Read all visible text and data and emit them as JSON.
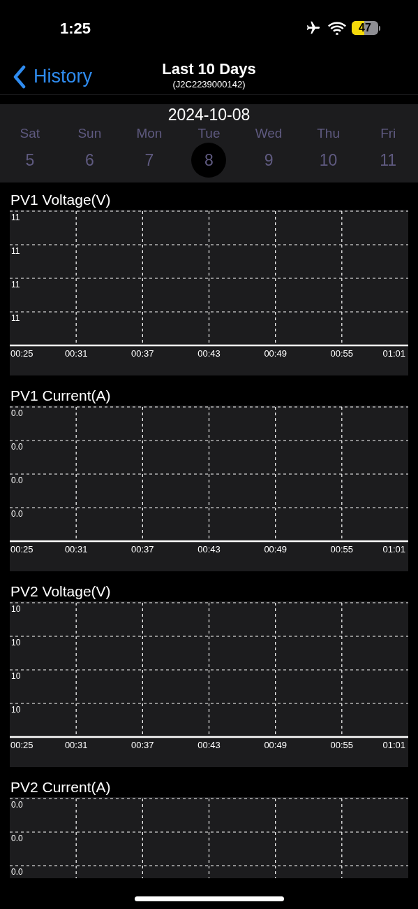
{
  "status_bar": {
    "time": "1:25",
    "battery": "47"
  },
  "nav": {
    "back": "History",
    "title": "Last 10 Days",
    "subtitle": "(J2C2239000142)"
  },
  "date_strip": {
    "date": "2024-10-08",
    "days": [
      {
        "weekday": "Sat",
        "day": "5",
        "selected": false
      },
      {
        "weekday": "Sun",
        "day": "6",
        "selected": false
      },
      {
        "weekday": "Mon",
        "day": "7",
        "selected": false
      },
      {
        "weekday": "Tue",
        "day": "8",
        "selected": true
      },
      {
        "weekday": "Wed",
        "day": "9",
        "selected": false
      },
      {
        "weekday": "Thu",
        "day": "10",
        "selected": false
      },
      {
        "weekday": "Fri",
        "day": "11",
        "selected": false
      }
    ]
  },
  "charts": [
    {
      "title": "PV1 Voltage(V)",
      "y_labels": [
        "11",
        "11",
        "11",
        "11"
      ],
      "x_labels": [
        "00:25",
        "00:31",
        "00:37",
        "00:43",
        "00:49",
        "00:55",
        "01:01"
      ]
    },
    {
      "title": "PV1 Current(A)",
      "y_labels": [
        "0.0",
        "0.0",
        "0.0",
        "0.0"
      ],
      "x_labels": [
        "00:25",
        "00:31",
        "00:37",
        "00:43",
        "00:49",
        "00:55",
        "01:01"
      ]
    },
    {
      "title": "PV2 Voltage(V)",
      "y_labels": [
        "10",
        "10",
        "10",
        "10"
      ],
      "x_labels": [
        "00:25",
        "00:31",
        "00:37",
        "00:43",
        "00:49",
        "00:55",
        "01:01"
      ]
    },
    {
      "title": "PV2 Current(A)",
      "y_labels": [
        "0.0",
        "0.0",
        "0.0"
      ]
    }
  ]
}
